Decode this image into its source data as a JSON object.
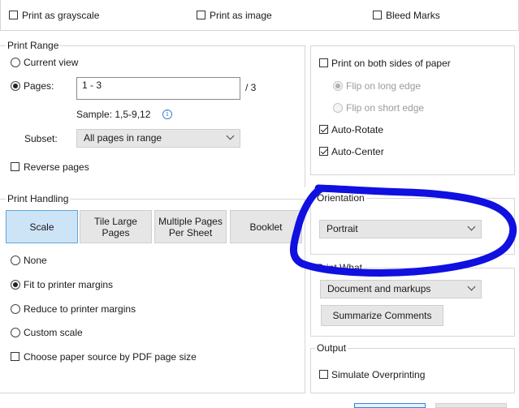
{
  "top_options": {
    "grayscale": "Print as grayscale",
    "as_image": "Print as image",
    "bleed_marks": "Bleed Marks"
  },
  "print_range": {
    "title": "Print Range",
    "current_view": "Current view",
    "pages_label": "Pages:",
    "pages_value": "1 - 3",
    "pages_total": "/ 3",
    "sample": "Sample: 1,5-9,12",
    "info_icon": "info-icon",
    "subset_label": "Subset:",
    "subset_value": "All pages in range",
    "reverse": "Reverse pages"
  },
  "duplex": {
    "both_sides": "Print on both sides of paper",
    "long_edge": "Flip on long edge",
    "short_edge": "Flip on short edge",
    "auto_rotate": "Auto-Rotate",
    "auto_center": "Auto-Center"
  },
  "print_handling": {
    "title": "Print Handling",
    "buttons": [
      "Scale",
      "Tile Large Pages",
      "Multiple Pages Per Sheet",
      "Booklet"
    ],
    "none": "None",
    "fit": "Fit to printer margins",
    "reduce": "Reduce to printer margins",
    "custom": "Custom scale",
    "paper_source": "Choose paper source by PDF page size"
  },
  "orientation": {
    "title": "Orientation",
    "value": "Portrait"
  },
  "print_what": {
    "title": "Print What",
    "value": "Document and markups",
    "summarize": "Summarize Comments"
  },
  "output": {
    "title": "Output",
    "simulate": "Simulate Overprinting"
  },
  "colors": {
    "annotation": "#1010e0",
    "active_button": "#cde4f7",
    "active_border": "#5ca7e0",
    "button_bg": "#e6e6e6"
  }
}
